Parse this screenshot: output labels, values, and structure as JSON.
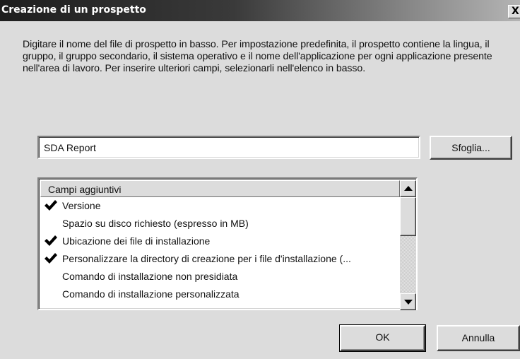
{
  "window": {
    "title": "Creazione di un prospetto",
    "close_glyph": "X"
  },
  "description": "Digitare il nome del file di prospetto in basso. Per impostazione predefinita, il prospetto contiene la lingua, il gruppo, il gruppo secondario, il sistema operativo e il nome dell'applicazione per ogni applicazione presente nell'area di lavoro. Per inserire ulteriori campi, selezionarli nell'elenco in basso.",
  "filename": {
    "value": "SDA Report"
  },
  "browse_button": {
    "label": "Sfoglia..."
  },
  "fields_list": {
    "header": "Campi aggiuntivi",
    "items": [
      {
        "label": "Versione",
        "checked": true
      },
      {
        "label": "Spazio su disco richiesto (espresso in MB)",
        "checked": false
      },
      {
        "label": "Ubicazione dei file di installazione",
        "checked": true
      },
      {
        "label": "Personalizzare la directory di creazione per i file d'installazione (...",
        "checked": true
      },
      {
        "label": "Comando di installazione non presidiata",
        "checked": false
      },
      {
        "label": "Comando di installazione personalizzata",
        "checked": false
      }
    ]
  },
  "buttons": {
    "ok_label": "OK",
    "cancel_label": "Annulla"
  },
  "icons": {
    "check": "check-icon",
    "scroll_up": "arrow-up-icon",
    "scroll_down": "arrow-down-icon"
  }
}
